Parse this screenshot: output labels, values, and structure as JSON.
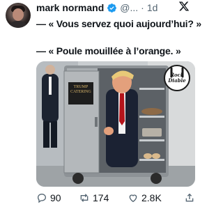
{
  "author": {
    "display_name": "mark normand",
    "handle": "@...",
    "separator": "·",
    "time": "1d"
  },
  "tweet": {
    "line1": "— « Vous servez quoi aujourd’hui? »",
    "line2": "— « Poule mouillée à l’orange. »"
  },
  "photo": {
    "cart_label": "TRUMP CATERING",
    "watermark_line1": "Rock",
    "watermark_line2": "Diable"
  },
  "metrics": {
    "replies": "90",
    "reposts": "174",
    "likes": "2.8K"
  },
  "colors": {
    "verified": "#1d9bf0",
    "secondary_text": "#536471"
  },
  "icons": [
    "verified-badge-icon",
    "x-logo-icon",
    "reply-icon",
    "repost-icon",
    "like-icon",
    "share-icon"
  ]
}
